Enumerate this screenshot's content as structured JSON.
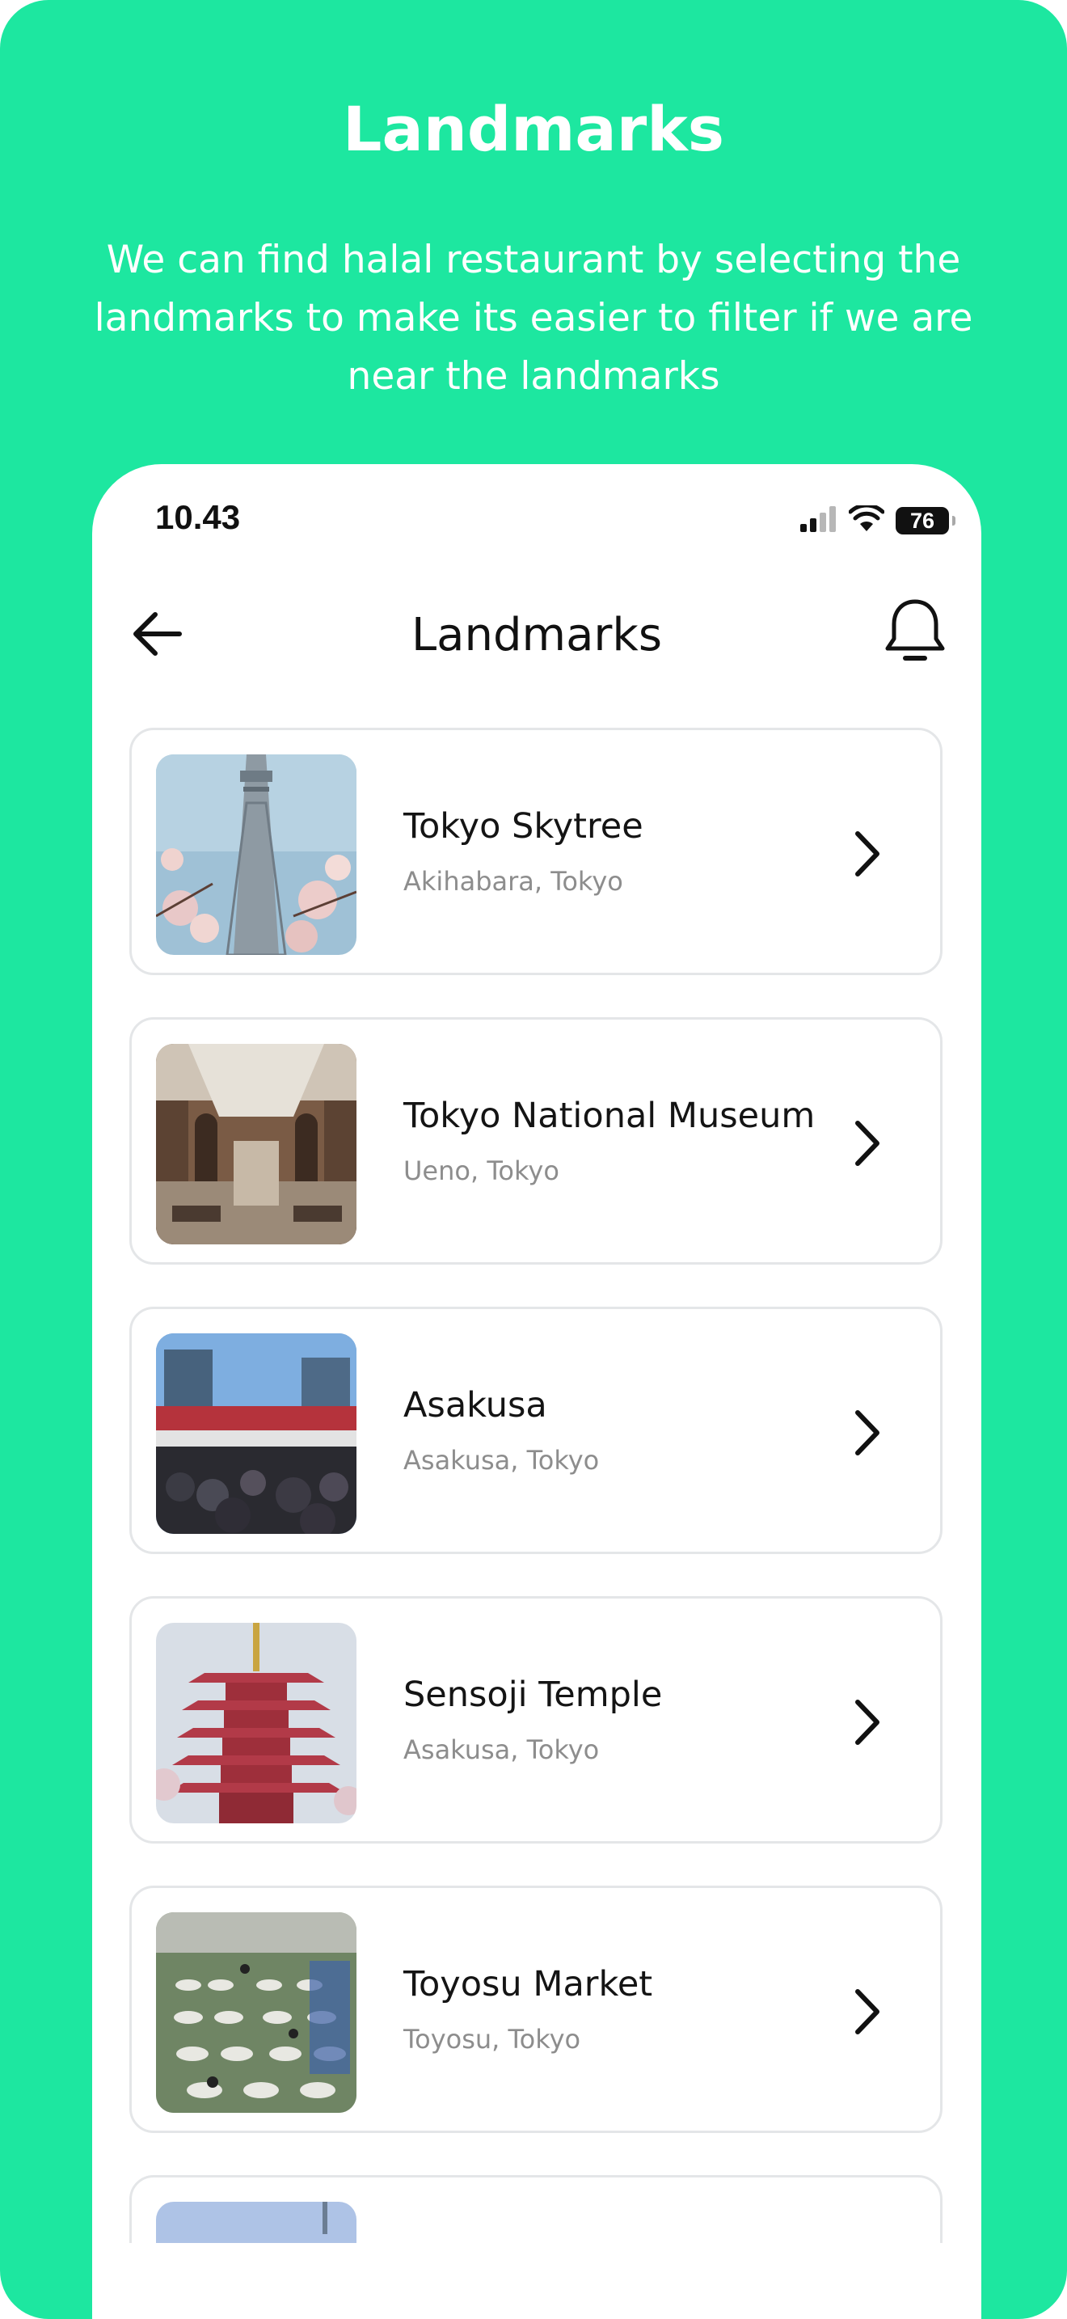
{
  "poster": {
    "title": "Landmarks",
    "subtitle": "We can find halal restaurant by selecting the landmarks to make its easier to filter if we are near the landmarks",
    "background_color": "#1de7a0"
  },
  "status_bar": {
    "time": "10.43",
    "battery": "76",
    "icons": [
      "cellular-signal-icon",
      "wifi-icon",
      "battery-icon"
    ]
  },
  "header": {
    "title": "Landmarks",
    "back_icon": "arrow-left-icon",
    "notification_icon": "bell-icon"
  },
  "landmarks": [
    {
      "name": "Tokyo Skytree",
      "location": "Akihabara, Tokyo",
      "image": "skytree-with-cherry-blossoms"
    },
    {
      "name": "Tokyo National Museum",
      "location": "Ueno, Tokyo",
      "image": "museum-interior-hall"
    },
    {
      "name": "Asakusa",
      "location": "Asakusa, Tokyo",
      "image": "crowded-shopping-street"
    },
    {
      "name": "Sensoji Temple",
      "location": "Asakusa, Tokyo",
      "image": "red-pagoda"
    },
    {
      "name": "Toyosu Market",
      "location": "Toyosu, Tokyo",
      "image": "fish-market-auction-floor"
    },
    {
      "name": "",
      "location": "",
      "image": "partially-visible-landmark"
    }
  ]
}
